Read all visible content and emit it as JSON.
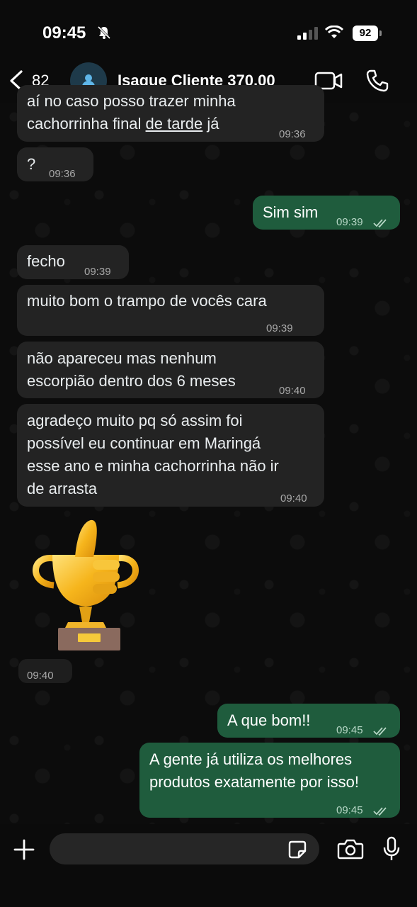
{
  "status_bar": {
    "time": "09:45",
    "battery": "92"
  },
  "header": {
    "unread_count": "82",
    "contact_name": "Isaque Cliente 370,00"
  },
  "messages": [
    {
      "dir": "in",
      "line1": "aí no caso posso trazer minha",
      "line2a": "cachorrinha final ",
      "line2b": "de tarde",
      "line2c": " já",
      "time": "09:36"
    },
    {
      "dir": "in",
      "text": "?",
      "time": "09:36"
    },
    {
      "dir": "out",
      "text": "Sim sim",
      "time": "09:39"
    },
    {
      "dir": "in",
      "text": "fecho",
      "time": "09:39"
    },
    {
      "dir": "in",
      "text": "muito bom o trampo de vocês cara",
      "time": "09:39"
    },
    {
      "dir": "in",
      "line1": "não apareceu mas nenhum",
      "line2": "escorpião dentro dos 6 meses",
      "time": "09:40"
    },
    {
      "dir": "in",
      "line1": "agradeço muito pq só assim foi",
      "line2": "possível eu continuar em Maringá",
      "line3": "esse ano e minha cachorrinha não ir",
      "line4": "de arrasta",
      "time": "09:40"
    },
    {
      "dir": "in",
      "type": "sticker",
      "sticker": "trophy-thumbs-up",
      "time": "09:40"
    },
    {
      "dir": "out",
      "text": "A que bom!!",
      "time": "09:45"
    },
    {
      "dir": "out",
      "line1": "A gente já utiliza os melhores",
      "line2": "produtos exatamente por isso!",
      "time": "09:45"
    }
  ],
  "colors": {
    "incoming": "#232323",
    "outgoing": "#1f5c3d",
    "background": "#0b0b0b"
  }
}
